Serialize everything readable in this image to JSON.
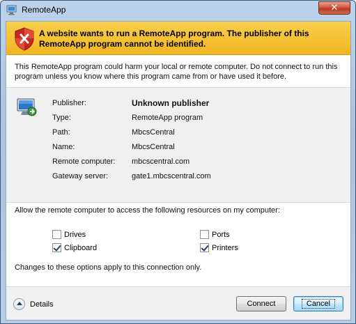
{
  "window": {
    "title": "RemoteApp",
    "close_label": "✕"
  },
  "banner": {
    "text": "A website wants to run a RemoteApp program. The publisher of this RemoteApp program cannot be identified."
  },
  "intro": {
    "text": "This RemoteApp program could harm your local or remote computer. Do not connect to run this program unless you know where this program came from or have used it before."
  },
  "info": {
    "rows": [
      {
        "label": "Publisher:",
        "value": "Unknown publisher"
      },
      {
        "label": "Type:",
        "value": "RemoteApp program"
      },
      {
        "label": "Path:",
        "value": "MbcsCentral"
      },
      {
        "label": "Name:",
        "value": "MbcsCentral"
      },
      {
        "label": "Remote computer:",
        "value": "mbcscentral.com"
      },
      {
        "label": "Gateway server:",
        "value": "gate1.mbcscentral.com"
      }
    ]
  },
  "resources": {
    "prompt": "Allow the remote computer to access the following resources on my computer:",
    "items": [
      {
        "label": "Drives",
        "checked": false
      },
      {
        "label": "Clipboard",
        "checked": true
      },
      {
        "label": "Ports",
        "checked": false
      },
      {
        "label": "Printers",
        "checked": true
      }
    ],
    "note": "Changes to these options apply to this connection only."
  },
  "footer": {
    "details_label": "Details",
    "connect_label": "Connect",
    "cancel_label": "Cancel"
  },
  "colors": {
    "banner": "#f1b521",
    "shield_red": "#c8281e",
    "default_button_border": "#3c7fb1"
  },
  "icons": {
    "title": "remoteapp-icon",
    "banner": "shield-error-icon",
    "app": "remote-computer-icon",
    "details": "chevron-up-icon"
  }
}
